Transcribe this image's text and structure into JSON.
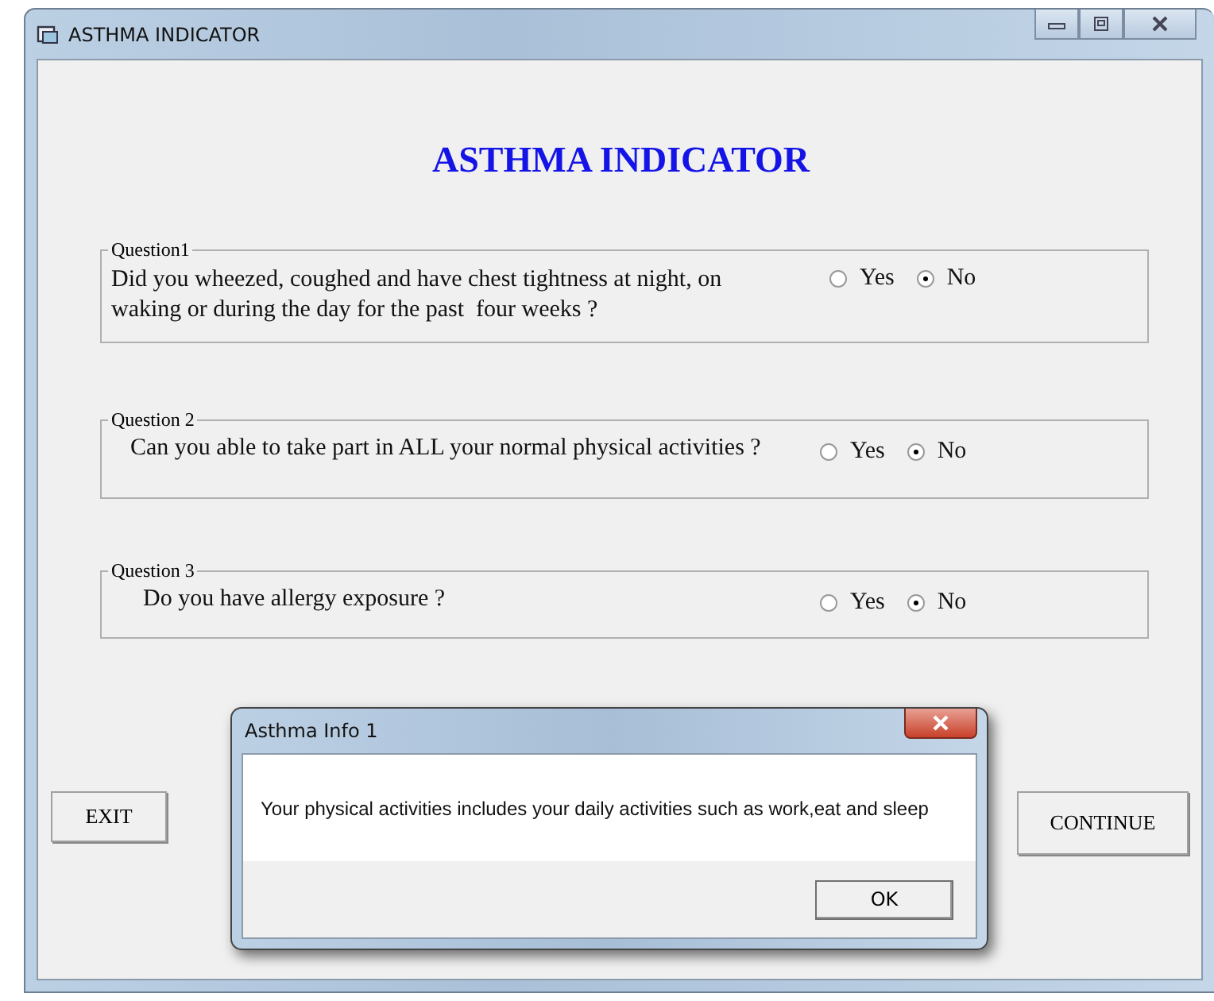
{
  "window": {
    "title": "ASTHMA INDICATOR"
  },
  "heading": "ASTHMA INDICATOR",
  "questions": [
    {
      "legend": "Question1",
      "text": "Did you wheezed, coughed and have chest tightness at night, on waking or during the day for the past  four weeks ?",
      "options": [
        {
          "label": "Yes",
          "selected": false
        },
        {
          "label": "No",
          "selected": true
        }
      ]
    },
    {
      "legend": "Question 2",
      "text": "Can you able to take part in ALL your normal physical activities ?",
      "options": [
        {
          "label": "Yes",
          "selected": false
        },
        {
          "label": "No",
          "selected": true
        }
      ]
    },
    {
      "legend": "Question 3",
      "text": "Do you have allergy exposure ?",
      "options": [
        {
          "label": "Yes",
          "selected": false
        },
        {
          "label": "No",
          "selected": true
        }
      ]
    }
  ],
  "buttons": [
    {
      "label": "EXIT",
      "kind": "exit"
    },
    {
      "label": "CONTINUE",
      "kind": "continue"
    }
  ],
  "dialog": {
    "title": "Asthma Info 1",
    "message": "Your physical activities includes your daily activities such as work,eat and sleep",
    "buttons": [
      "OK"
    ]
  }
}
